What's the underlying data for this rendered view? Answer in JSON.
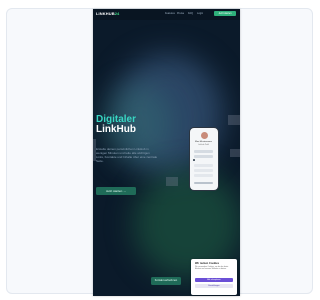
{
  "nav": {
    "logo_main": "LINKHUB",
    "logo_accent": "24",
    "links": [
      "Features",
      "Preise",
      "FAQ",
      "Login"
    ],
    "cta": "Jetzt starten"
  },
  "hero": {
    "title_line1": "Digitaler",
    "title_line2": "LinkHub",
    "description": "Erstelle deinen persönlichen LinkHub in wenigen Minuten und teile alle wichtigen Links, Kontakte und Inhalte über eine zentrale Seite.",
    "cta": "Jetzt starten →"
  },
  "phone": {
    "name": "Max Mustermann",
    "subtitle": "Linkhub Profil"
  },
  "footer": {
    "button": "Kontakt aufnehmen"
  },
  "cookie": {
    "title": "Wir nutzen Cookies",
    "text": "Wir verwenden Cookies, um dir das beste Erlebnis auf unserer Website zu bieten.",
    "accept": "Alle akzeptieren",
    "settings": "Einstellungen"
  },
  "colors": {
    "page_bg": "#0b1a2a",
    "title_accent": "#38d6c3",
    "cta_green": "#1f6b58",
    "cookie_primary": "#6b4fd6"
  }
}
